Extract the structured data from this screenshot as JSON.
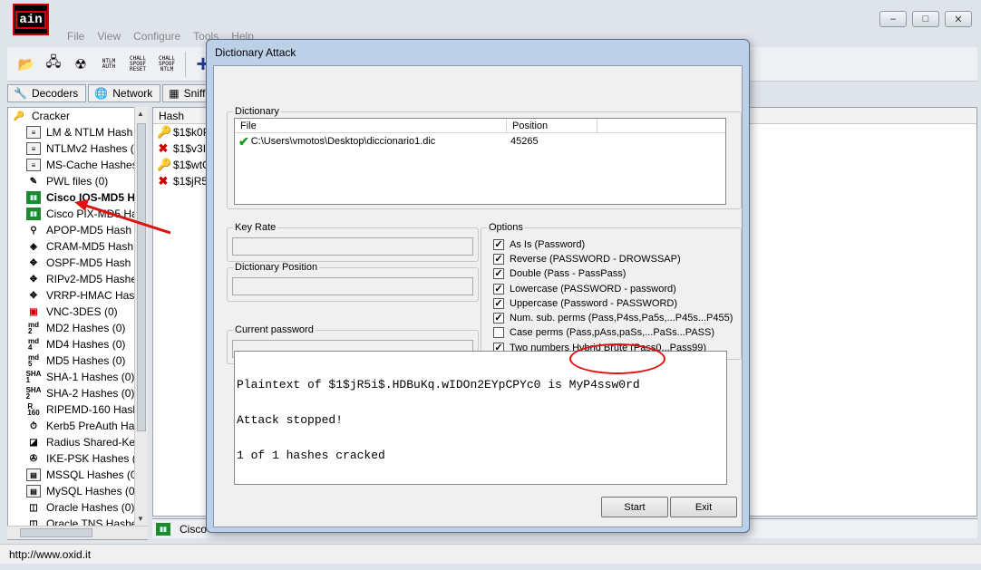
{
  "app": {
    "icon_text": "ain",
    "menu": [
      "File",
      "View",
      "Configure",
      "Tools",
      "Help"
    ],
    "window_buttons": [
      "–",
      "□",
      "✕"
    ],
    "toolbar": {
      "ntlm_auth": "NTLM AUTH",
      "chall_spoof_reset": "CHALL SPOOF RESET",
      "chall_spoof_ntlm": "CHALL SPOOF NTLM"
    },
    "tabs": [
      "Decoders",
      "Network",
      "Sniff"
    ],
    "tree_root": "Cracker",
    "tree_items": [
      "LM & NTLM Hash",
      "NTLMv2 Hashes (",
      "MS-Cache Hashes",
      "PWL files (0)",
      "Cisco IOS-MD5 H",
      "Cisco PIX-MD5 Ha",
      "APOP-MD5 Hash",
      "CRAM-MD5 Hash",
      "OSPF-MD5 Hash",
      "RIPv2-MD5 Hashe",
      "VRRP-HMAC Has",
      "VNC-3DES (0)",
      "MD2 Hashes (0)",
      "MD4 Hashes (0)",
      "MD5 Hashes (0)",
      "SHA-1 Hashes (0)",
      "SHA-2 Hashes (0)",
      "RIPEMD-160 Hash",
      "Kerb5 PreAuth Ha",
      "Radius Shared-Ke",
      "IKE-PSK Hashes (",
      "MSSQL Hashes (0",
      "MySQL Hashes (0",
      "Oracle Hashes (0)",
      "Oracle TNS Hashe"
    ],
    "hash_header": "Hash",
    "hash_rows": [
      "$1$k0P",
      "$1$v3Ih",
      "$1$wtC",
      "$1$jR5i"
    ],
    "bottom_tab": "Cisco",
    "status": "http://www.oxid.it"
  },
  "dialog": {
    "title": "Dictionary Attack",
    "dictionary_legend": "Dictionary",
    "col_file": "File",
    "col_position": "Position",
    "file_path": "C:\\Users\\vmotos\\Desktop\\diccionario1.dic",
    "position_value": "45265",
    "key_rate_label": "Key Rate",
    "dict_position_label": "Dictionary Position",
    "current_password_label": "Current password",
    "options_legend": "Options",
    "options": [
      {
        "label": "As Is (Password)",
        "checked": true
      },
      {
        "label": "Reverse (PASSWORD - DROWSSAP)",
        "checked": true
      },
      {
        "label": "Double (Pass - PassPass)",
        "checked": true
      },
      {
        "label": "Lowercase (PASSWORD - password)",
        "checked": true
      },
      {
        "label": "Uppercase (Password - PASSWORD)",
        "checked": true
      },
      {
        "label": "Num. sub. perms (Pass,P4ss,Pa5s,...P45s...P455)",
        "checked": true
      },
      {
        "label": "Case perms (Pass,pAss,paSs,...PaSs...PASS)",
        "checked": false
      },
      {
        "label": "Two numbers Hybrid Brute (Pass0...Pass99)",
        "checked": true
      }
    ],
    "console_lines": [
      "Plaintext of $1$jR5i$.HDBuKq.wIDOn2EYpCPYc0 is MyP4ssw0rd",
      "Attack stopped!",
      "1 of 1 hashes cracked"
    ],
    "start_button": "Start",
    "exit_button": "Exit"
  },
  "colors": {
    "annotation_red": "#e01010",
    "dialog_frame": "#bcd0e8"
  }
}
